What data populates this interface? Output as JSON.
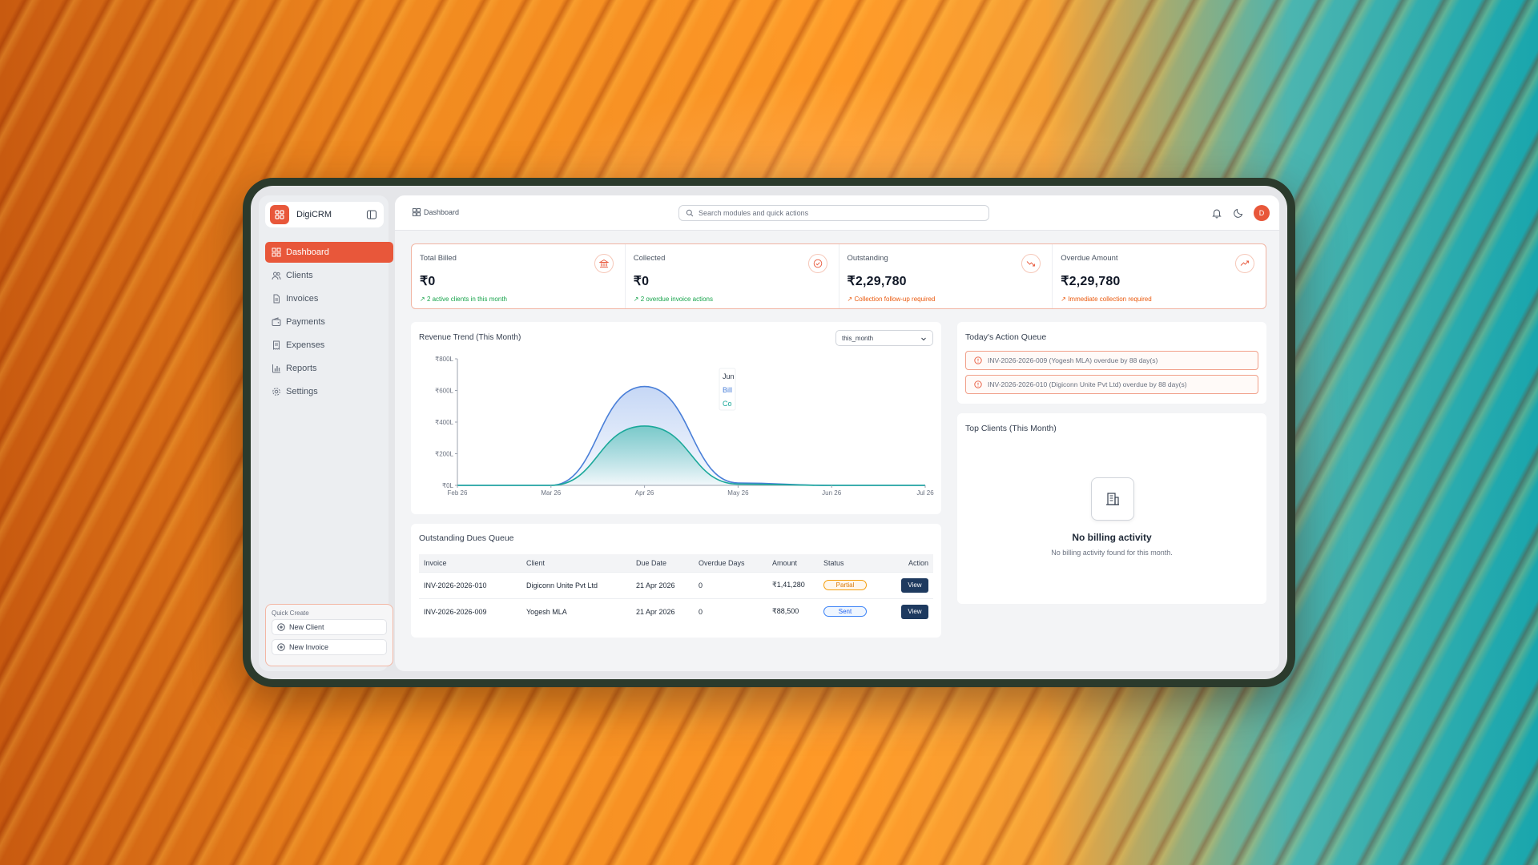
{
  "app": {
    "name": "DigiCRM"
  },
  "sidebar": {
    "items": [
      {
        "label": "Dashboard",
        "icon": "grid-icon"
      },
      {
        "label": "Clients",
        "icon": "users-icon"
      },
      {
        "label": "Invoices",
        "icon": "file-icon"
      },
      {
        "label": "Payments",
        "icon": "wallet-icon"
      },
      {
        "label": "Expenses",
        "icon": "receipt-icon"
      },
      {
        "label": "Reports",
        "icon": "bar-chart-icon"
      },
      {
        "label": "Settings",
        "icon": "gear-icon"
      }
    ],
    "quick_create": {
      "title": "Quick Create",
      "new_client": "New Client",
      "new_invoice": "New Invoice"
    }
  },
  "header": {
    "breadcrumb": "Dashboard",
    "search_placeholder": "Search modules and quick actions",
    "avatar_initial": "D"
  },
  "stats": [
    {
      "label": "Total Billed",
      "value": "₹0",
      "note": "2 active clients in this month",
      "note_color": "#16a34a",
      "icon": "bank-icon"
    },
    {
      "label": "Collected",
      "value": "₹0",
      "note": "2 overdue invoice actions",
      "note_color": "#16a34a",
      "icon": "check-circle-icon"
    },
    {
      "label": "Outstanding",
      "value": "₹2,29,780",
      "note": "Collection follow-up required",
      "note_color": "#ea580c",
      "icon": "trending-down-icon"
    },
    {
      "label": "Overdue Amount",
      "value": "₹2,29,780",
      "note": "Immediate collection required",
      "note_color": "#ea580c",
      "icon": "trending-up-icon"
    }
  ],
  "revenue": {
    "title": "Revenue Trend (This Month)",
    "filter_value": "this_month",
    "tooltip": {
      "title": "Jun",
      "line1": "Bill",
      "line2": "Co"
    }
  },
  "chart_data": {
    "type": "area",
    "x": [
      "Feb 26",
      "Mar 26",
      "Apr 26",
      "May 26",
      "Jun 26",
      "Jul 26"
    ],
    "y_ticks": [
      "₹0L",
      "₹200L",
      "₹400L",
      "₹600L",
      "₹800L"
    ],
    "ylim": [
      0,
      800
    ],
    "series": [
      {
        "name": "Bill",
        "color": "#4a7fd8",
        "values": [
          0,
          0,
          625,
          15,
          0,
          0
        ]
      },
      {
        "name": "Co",
        "color": "#1aa89a",
        "values": [
          0,
          0,
          375,
          8,
          0,
          0
        ]
      }
    ]
  },
  "dues": {
    "title": "Outstanding Dues Queue",
    "columns": [
      "Invoice",
      "Client",
      "Due Date",
      "Overdue Days",
      "Amount",
      "Status",
      "Action"
    ],
    "rows": [
      {
        "invoice": "INV-2026-2026-010",
        "client": "Digiconn Unite Pvt Ltd",
        "due": "21 Apr 2026",
        "days": "0",
        "amount": "₹1,41,280",
        "status": "Partial",
        "action": "View"
      },
      {
        "invoice": "INV-2026-2026-009",
        "client": "Yogesh MLA",
        "due": "21 Apr 2026",
        "days": "0",
        "amount": "₹88,500",
        "status": "Sent",
        "action": "View"
      }
    ]
  },
  "action_queue": {
    "title": "Today's Action Queue",
    "items": [
      "INV-2026-2026-009 (Yogesh MLA) overdue by 88 day(s)",
      "INV-2026-2026-010 (Digiconn Unite Pvt Ltd) overdue by 88 day(s)"
    ]
  },
  "top_clients": {
    "title": "Top Clients (This Month)",
    "empty_title": "No billing activity",
    "empty_sub": "No billing activity found for this month."
  },
  "colors": {
    "accent": "#e8573a",
    "navy": "#1e3a5f"
  }
}
